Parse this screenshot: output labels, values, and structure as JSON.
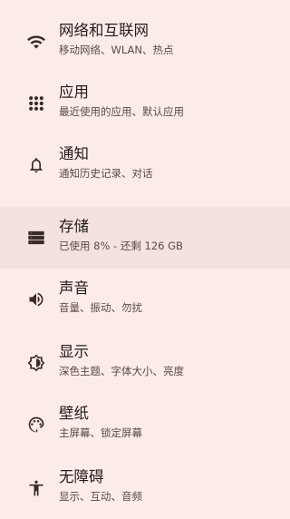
{
  "settings": {
    "items": [
      {
        "icon": "wifi-icon",
        "title": "网络和互联网",
        "summary": "移动网络、WLAN、热点"
      },
      {
        "icon": "apps-grid-icon",
        "title": "应用",
        "summary": "最近使用的应用、默认应用"
      },
      {
        "icon": "bell-icon",
        "title": "通知",
        "summary": "通知历史记录、对话"
      },
      {
        "icon": "storage-icon",
        "title": "存储",
        "summary": "已使用 8% - 还剩 126 GB"
      },
      {
        "icon": "volume-icon",
        "title": "声音",
        "summary": "音量、振动、勿扰"
      },
      {
        "icon": "brightness-icon",
        "title": "显示",
        "summary": "深色主题、字体大小、亮度"
      },
      {
        "icon": "palette-icon",
        "title": "壁纸",
        "summary": "主屏幕、锁定屏幕"
      },
      {
        "icon": "accessibility-icon",
        "title": "无障碍",
        "summary": "显示、互动、音频"
      }
    ]
  },
  "colors": {
    "background": "#fbecea",
    "highlight": "#f3e2e0",
    "title_text": "#231a19",
    "summary_text": "#5a4a48"
  }
}
